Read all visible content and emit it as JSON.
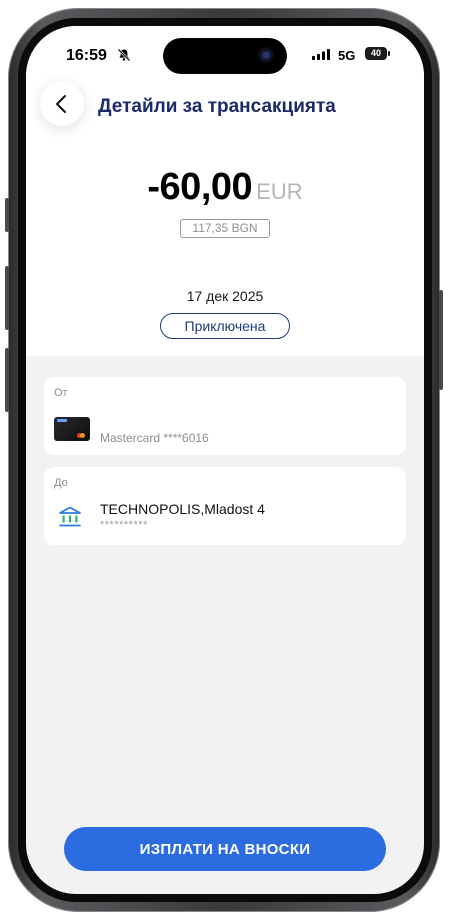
{
  "status_bar": {
    "time": "16:59",
    "network": "5G",
    "battery": "40"
  },
  "header": {
    "back_icon": "chevron-left-icon",
    "title": "Детайли за трансакцията"
  },
  "transaction": {
    "amount": "-60,00",
    "currency": "EUR",
    "secondary_amount": "117,35 BGN",
    "date": "17 дек 2025",
    "status": "Приключена"
  },
  "from": {
    "label": "От",
    "card_text": "Mastercard ****6016"
  },
  "to": {
    "label": "До",
    "name": "TECHNOPOLIS,Mladost 4",
    "account": "**********"
  },
  "actions": {
    "pay_installments": "ИЗПЛАТИ НА ВНОСКИ"
  },
  "colors": {
    "accent": "#2b6de0",
    "title": "#1b2a6b",
    "badge": "#1e3a7a",
    "bank_icon": "#2a7de1",
    "bank_icon_accent": "#2fb56a"
  }
}
